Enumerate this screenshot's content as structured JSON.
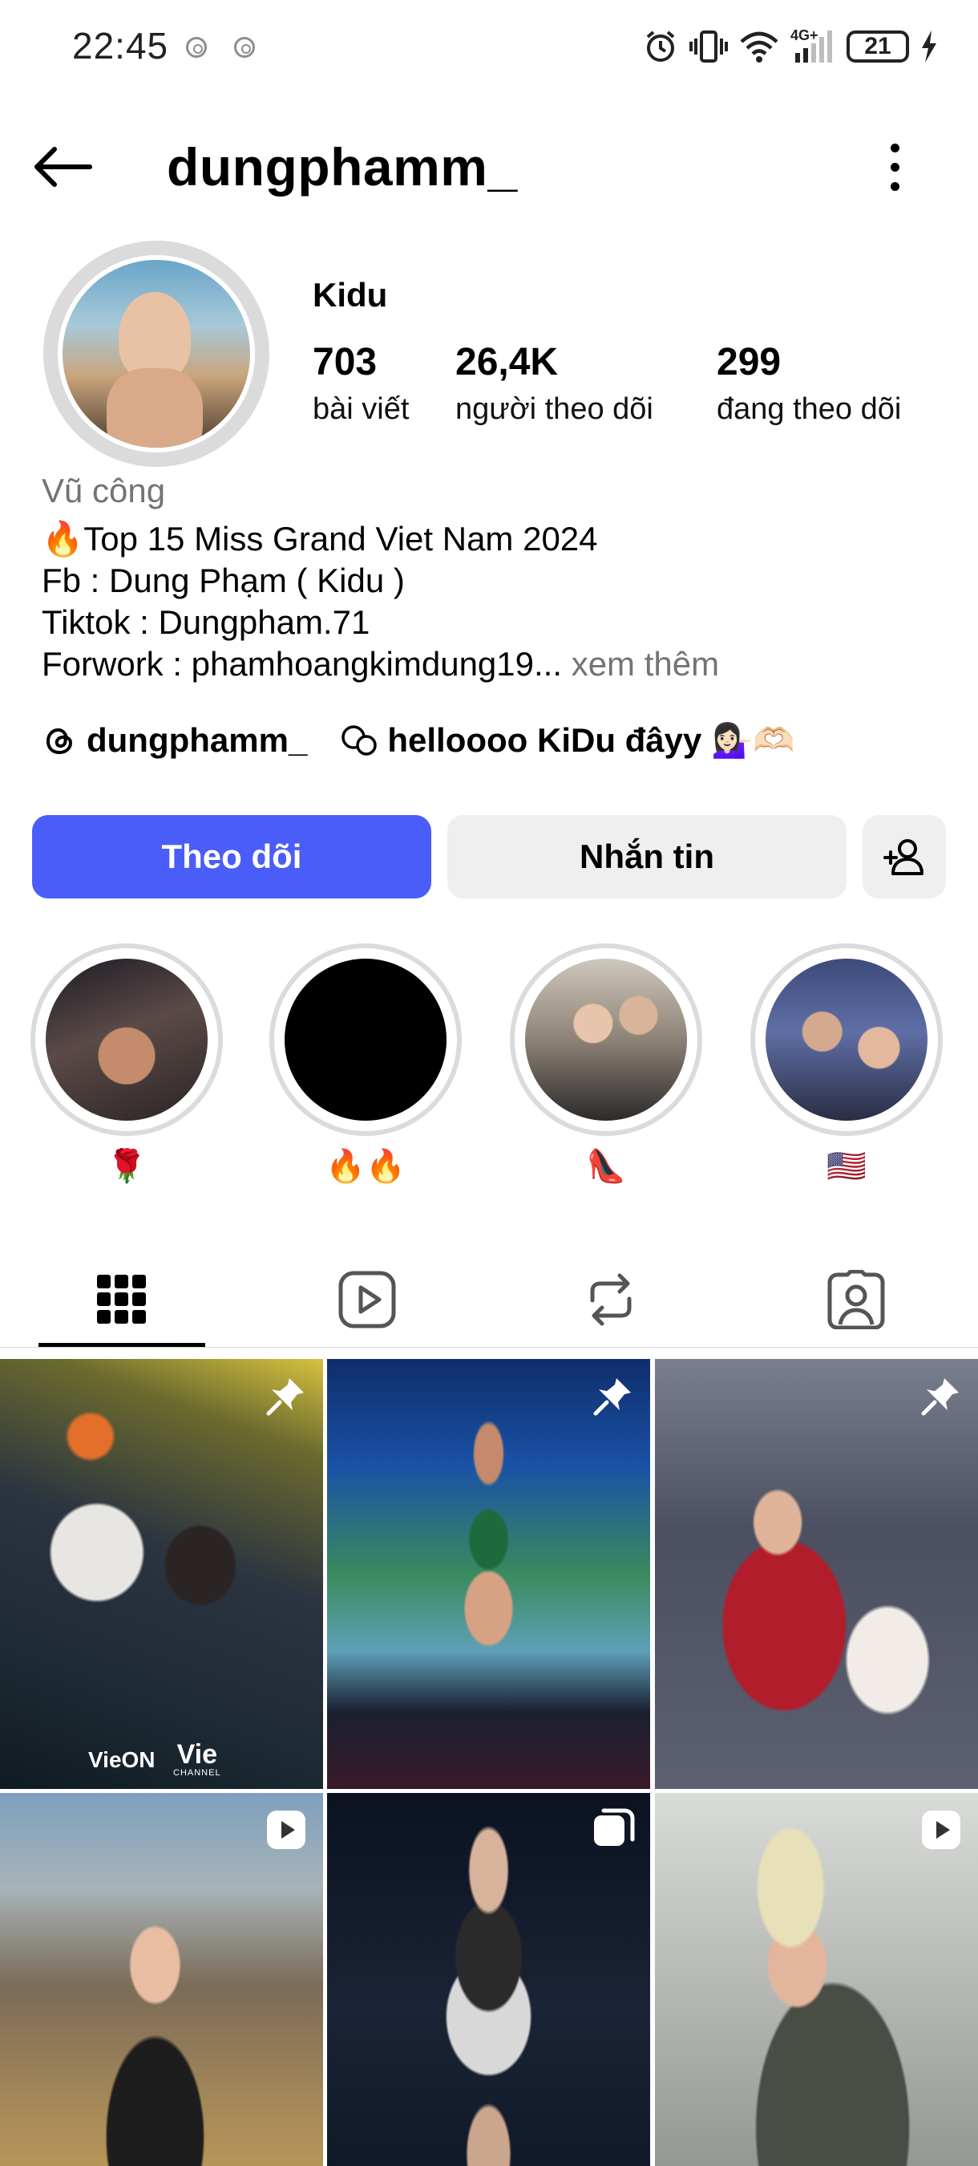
{
  "status_bar": {
    "time": "22:45",
    "network": "4G+",
    "battery": "21"
  },
  "header": {
    "username": "dungphamm_",
    "back_icon": "arrow-left-icon",
    "more_icon": "more-vertical-icon"
  },
  "profile": {
    "display_name": "Kidu",
    "stats": [
      {
        "value": "703",
        "label": "bài viết"
      },
      {
        "value": "26,4K",
        "label": "người theo dõi"
      },
      {
        "value": "299",
        "label": "đang theo dõi"
      }
    ],
    "category": "Vũ công",
    "bio": {
      "line1": "🔥Top 15 Miss Grand Viet Nam 2024",
      "line2": "Fb : Dung Phạm ( Kidu )",
      "line3": "Tiktok : Dungpham.71",
      "line4": "Forwork : phamhoangkimdung19...",
      "more": "xem thêm"
    },
    "threads_handle": "dungphamm_",
    "note": "helloooo KiDu đâyy 💁🏻‍♀️🫶🏻"
  },
  "actions": {
    "follow": "Theo dõi",
    "message": "Nhắn tin",
    "follow_color": "#4a5df9"
  },
  "highlights": [
    {
      "label": "🌹"
    },
    {
      "label": "🔥🔥"
    },
    {
      "label": "👠"
    },
    {
      "label": "🇺🇸"
    }
  ],
  "tabs": [
    {
      "icon": "grid-icon",
      "active": true
    },
    {
      "icon": "reels-icon",
      "active": false
    },
    {
      "icon": "repost-icon",
      "active": false
    },
    {
      "icon": "tagged-icon",
      "active": false
    }
  ],
  "posts": [
    {
      "badge": "pin-icon"
    },
    {
      "badge": "pin-icon"
    },
    {
      "badge": "pin-icon"
    },
    {
      "badge": "reel-icon"
    },
    {
      "badge": "carousel-icon"
    },
    {
      "badge": "reel-icon"
    }
  ],
  "post_text": {
    "logo_left": "VieON",
    "logo_right": "Vie",
    "logo_right_sub": "CHANNEL"
  }
}
